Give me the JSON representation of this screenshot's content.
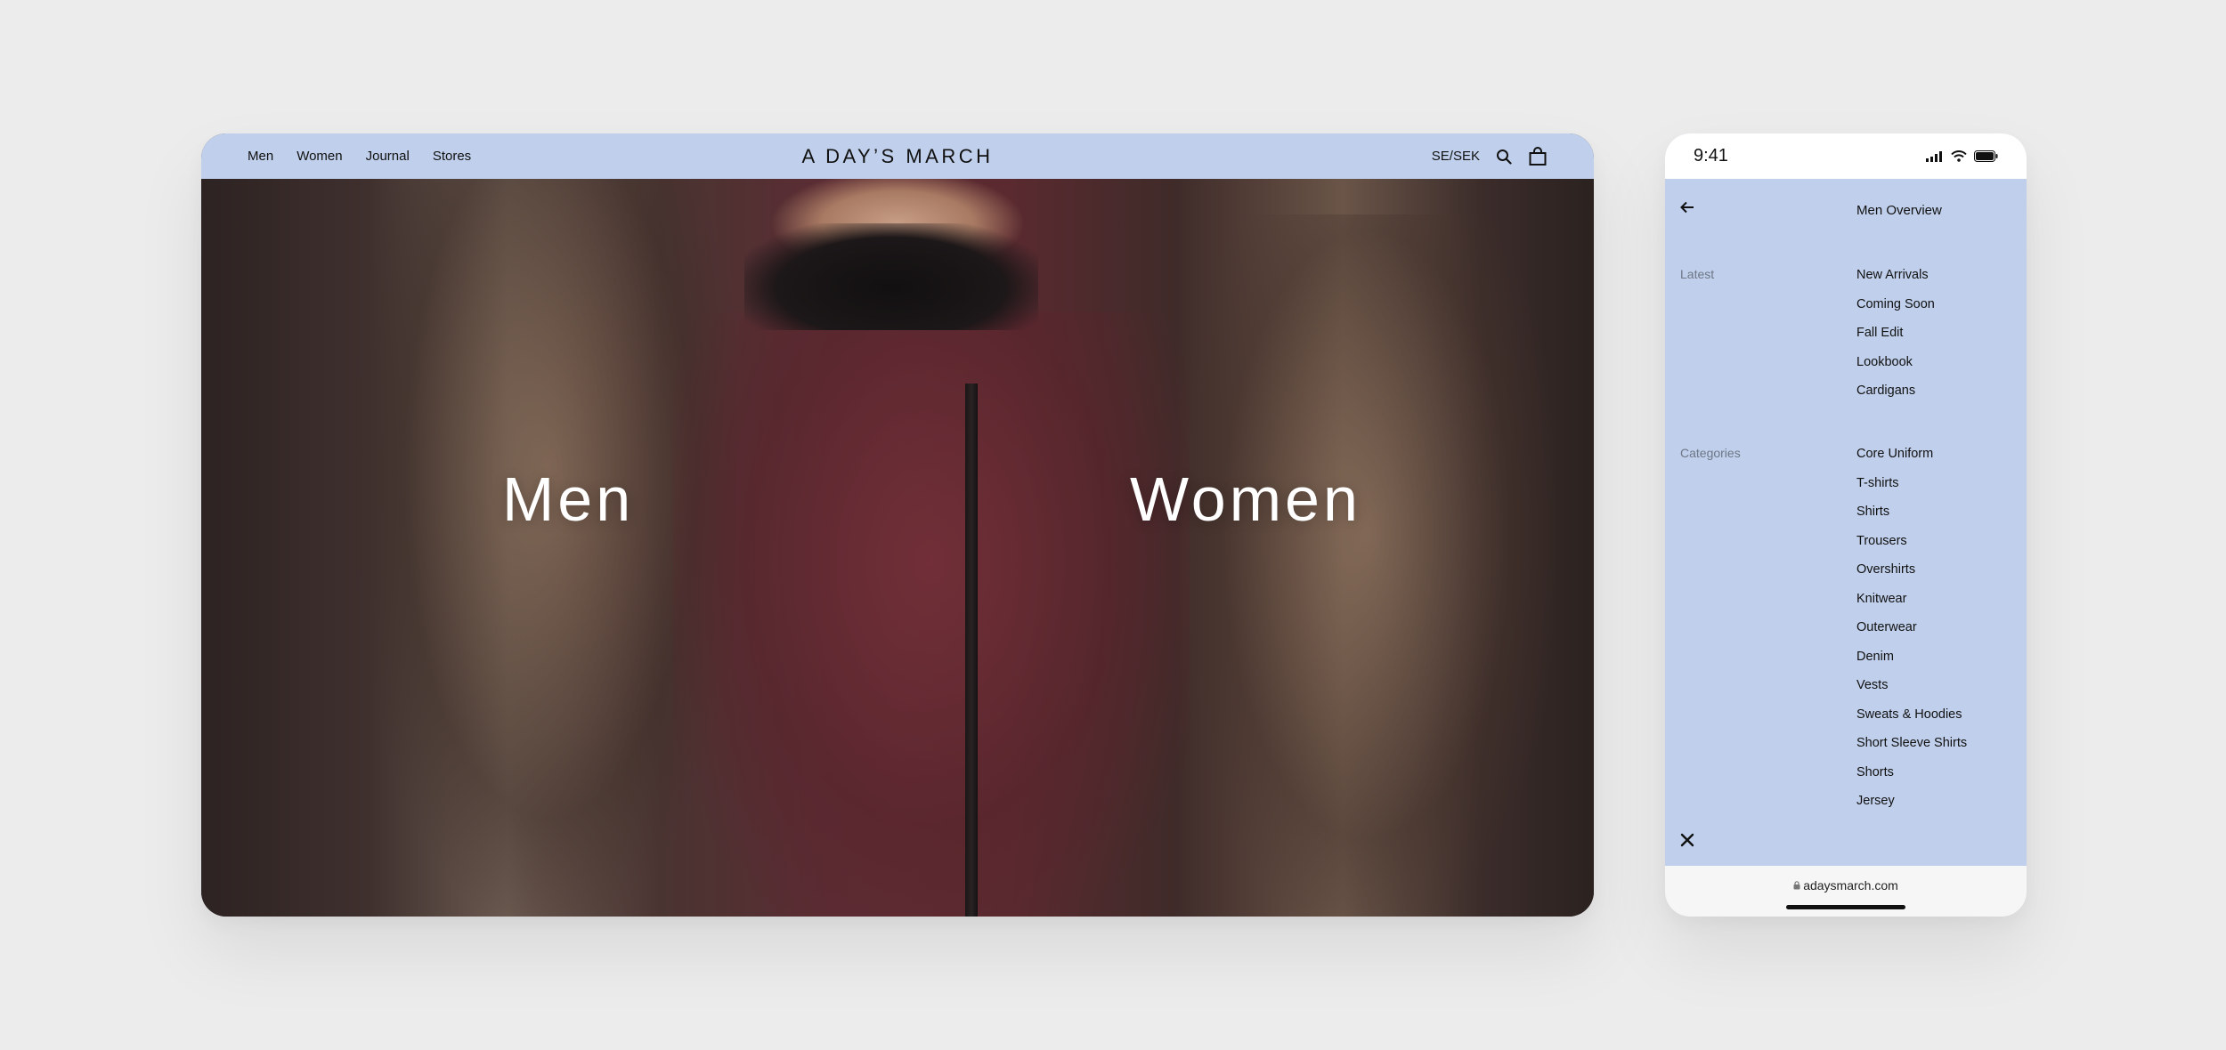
{
  "desktop": {
    "nav": [
      {
        "label": "Men"
      },
      {
        "label": "Women"
      },
      {
        "label": "Journal"
      },
      {
        "label": "Stores"
      }
    ],
    "logo": "A DAY’S MARCH",
    "locale": "SE/SEK",
    "hero": {
      "men_label": "Men",
      "women_label": "Women"
    },
    "colors": {
      "header_bg": "#c0d0ec",
      "hero_text": "#ffffff"
    }
  },
  "mobile": {
    "status": {
      "time": "9:41"
    },
    "menu": {
      "title": "Men Overview",
      "latest": {
        "label": "Latest",
        "items": [
          "New Arrivals",
          "Coming Soon",
          "Fall Edit",
          "Lookbook",
          "Cardigans"
        ]
      },
      "categories": {
        "label": "Categories",
        "items": [
          "Core Uniform",
          "T-shirts",
          "Shirts",
          "Trousers",
          "Overshirts",
          "Knitwear",
          "Outerwear",
          "Denim",
          "Vests",
          "Sweats & Hoodies",
          "Short Sleeve Shirts",
          "Shorts",
          "Jersey"
        ]
      }
    },
    "url": "adaysmarch.com",
    "colors": {
      "menu_bg": "#c0d0ec",
      "group_label": "#6d7685"
    }
  },
  "icons": [
    "search-icon",
    "bag-icon",
    "back-arrow-icon",
    "close-icon",
    "signal-icon",
    "wifi-icon",
    "battery-icon",
    "lock-icon"
  ]
}
